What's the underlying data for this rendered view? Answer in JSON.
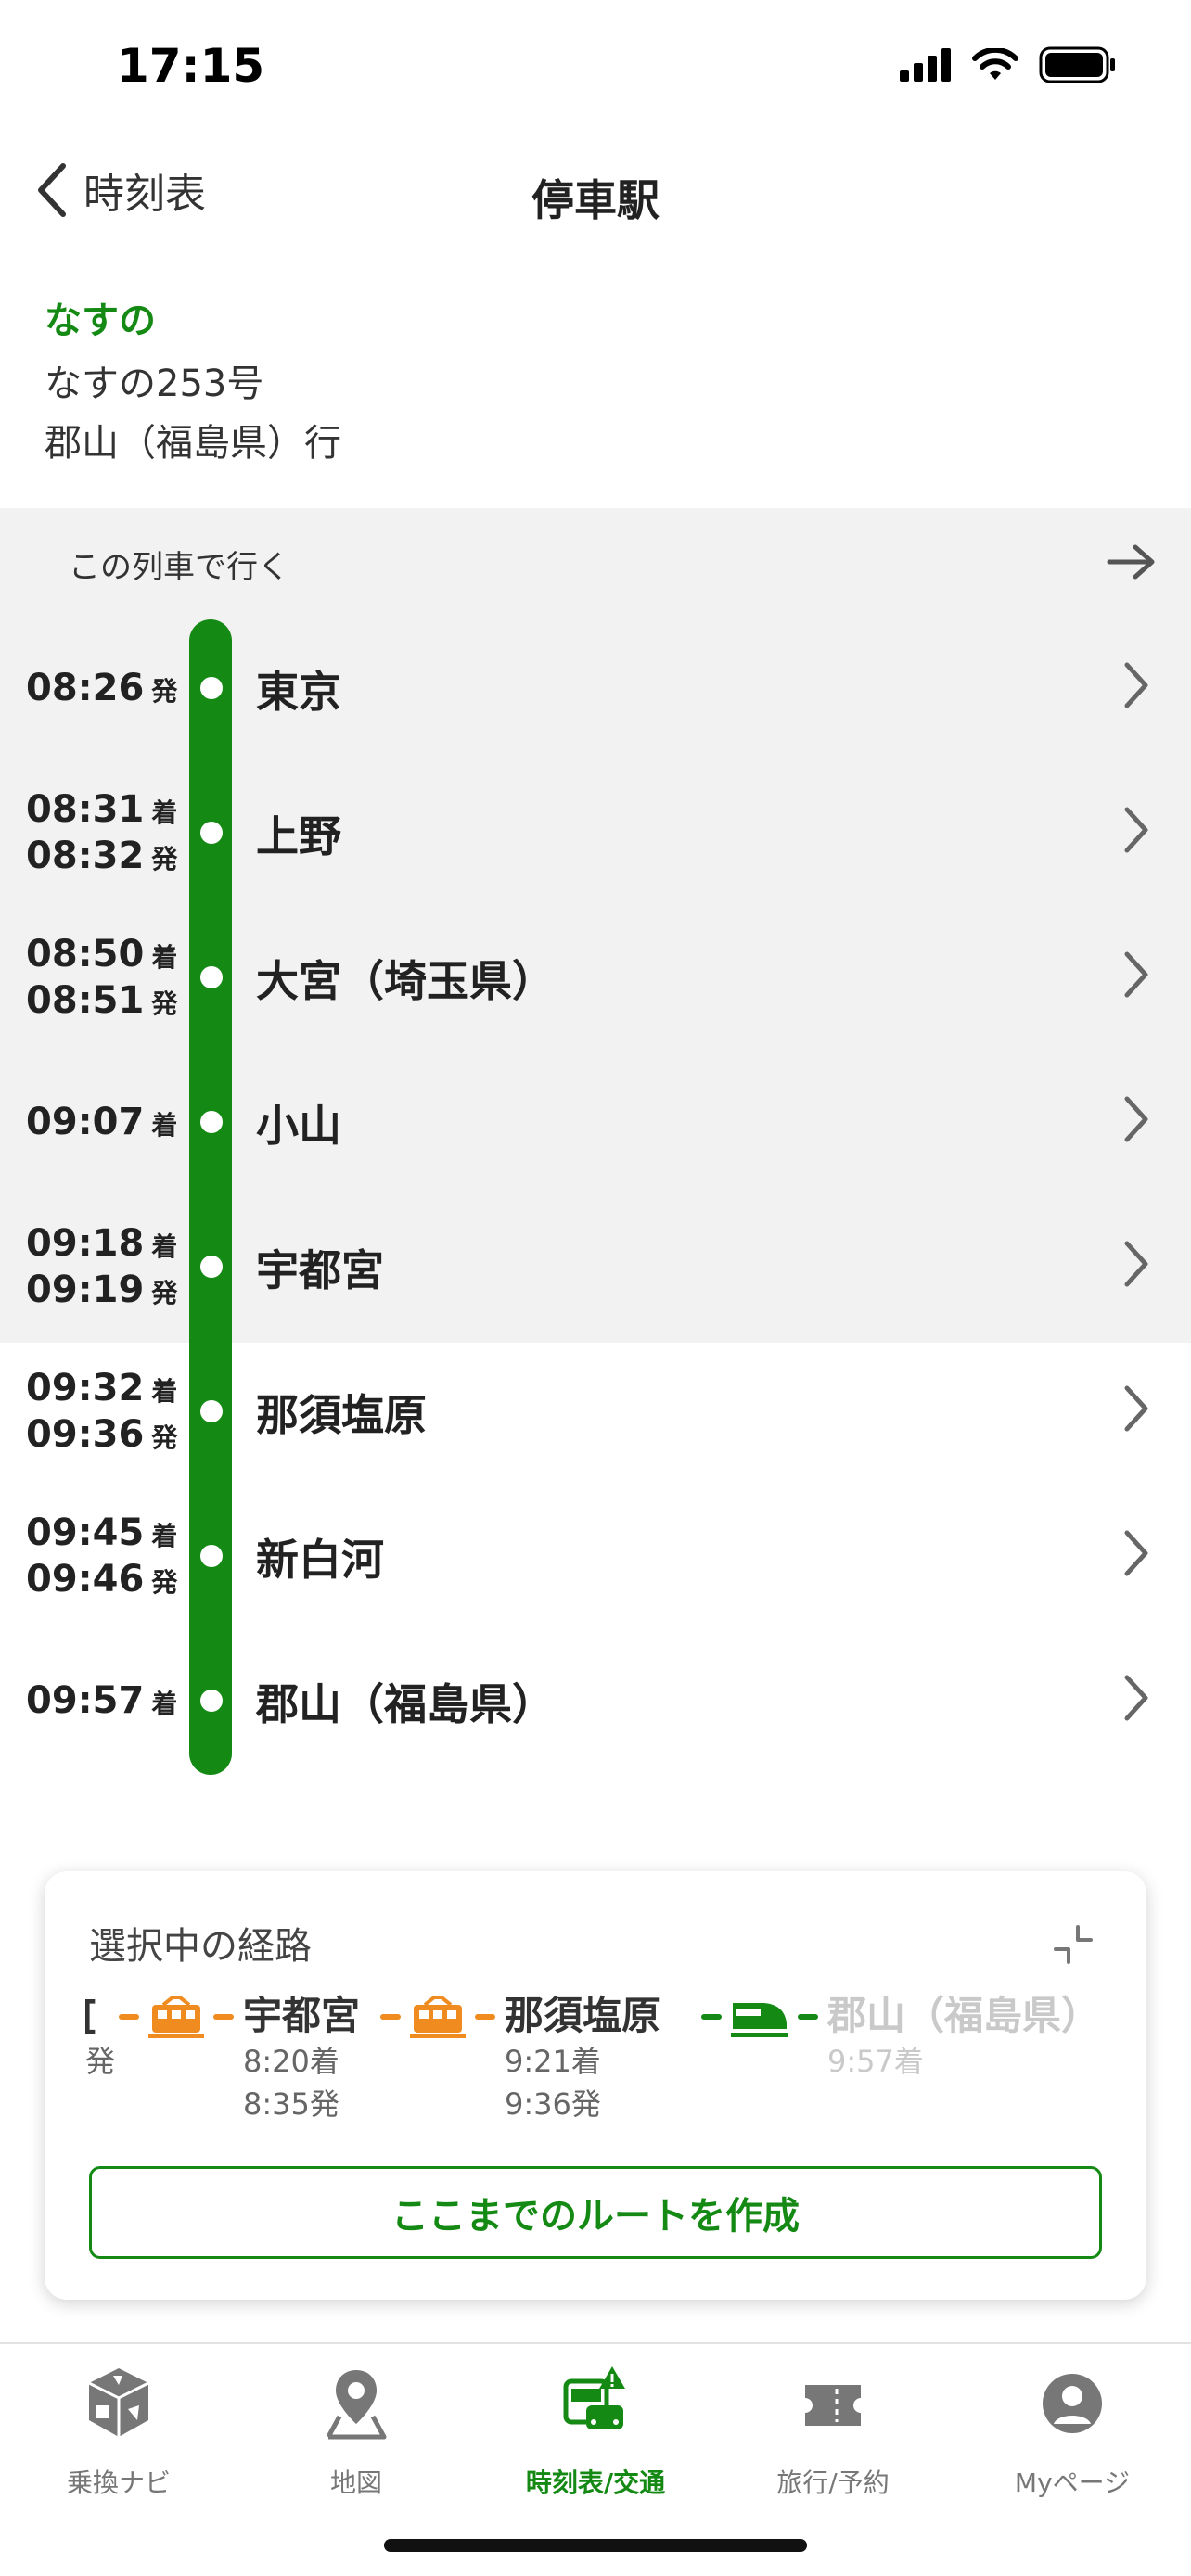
{
  "status_bar": {
    "time": "17:15"
  },
  "nav": {
    "back_label": "時刻表",
    "title": "停車駅"
  },
  "train": {
    "name": "なすの",
    "number": "なすの253号",
    "destination": "郡山（福島県）行"
  },
  "ride_this_train_label": "この列車で行く",
  "stops": [
    {
      "name": "東京",
      "times": [
        {
          "time": "08:26",
          "kind": "発"
        }
      ]
    },
    {
      "name": "上野",
      "times": [
        {
          "time": "08:31",
          "kind": "着"
        },
        {
          "time": "08:32",
          "kind": "発"
        }
      ]
    },
    {
      "name": "大宮（埼玉県）",
      "times": [
        {
          "time": "08:50",
          "kind": "着"
        },
        {
          "time": "08:51",
          "kind": "発"
        }
      ]
    },
    {
      "name": "小山",
      "times": [
        {
          "time": "09:07",
          "kind": "着"
        }
      ]
    },
    {
      "name": "宇都宮",
      "times": [
        {
          "time": "09:18",
          "kind": "着"
        },
        {
          "time": "09:19",
          "kind": "発"
        }
      ]
    },
    {
      "name": "那須塩原",
      "times": [
        {
          "time": "09:32",
          "kind": "着"
        },
        {
          "time": "09:36",
          "kind": "発"
        }
      ]
    },
    {
      "name": "新白河",
      "times": [
        {
          "time": "09:45",
          "kind": "着"
        },
        {
          "time": "09:46",
          "kind": "発"
        }
      ]
    },
    {
      "name": "郡山（福島県）",
      "times": [
        {
          "time": "09:57",
          "kind": "着"
        }
      ]
    }
  ],
  "route_card": {
    "title": "選択中の経路",
    "first_partial_name": "[",
    "first_partial_time": "発",
    "stations": [
      {
        "name": "宇都宮",
        "arrive": "8:20着",
        "depart": "8:35発"
      },
      {
        "name": "那須塩原",
        "arrive": "9:21着",
        "depart": "9:36発"
      },
      {
        "name": "郡山（福島県）",
        "arrive": "9:57着"
      }
    ],
    "create_button": "ここまでのルートを作成"
  },
  "tabs": [
    {
      "label": "乗換ナビ",
      "icon": "transfer-navi-icon"
    },
    {
      "label": "地図",
      "icon": "map-icon"
    },
    {
      "label": "時刻表/交通",
      "icon": "timetable-transport-icon"
    },
    {
      "label": "旅行/予約",
      "icon": "ticket-icon"
    },
    {
      "label": "Myページ",
      "icon": "person-icon"
    }
  ],
  "colors": {
    "accent": "#148a14",
    "train_segment": "#f08b1f",
    "gray_bg": "#f2f2f2"
  }
}
